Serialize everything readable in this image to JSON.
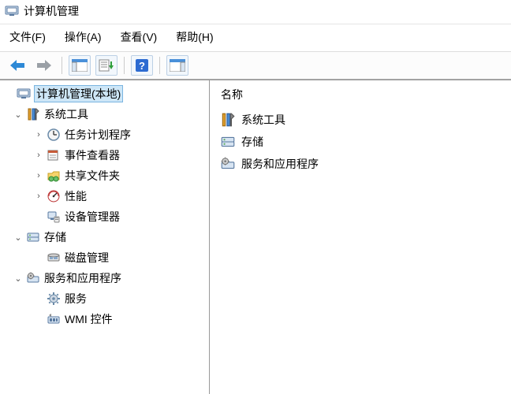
{
  "titlebar": {
    "title": "计算机管理"
  },
  "menu": {
    "file": "文件(F)",
    "action": "操作(A)",
    "view": "查看(V)",
    "help": "帮助(H)"
  },
  "tree": {
    "root": "计算机管理(本地)",
    "system_tools": "系统工具",
    "task_scheduler": "任务计划程序",
    "event_viewer": "事件查看器",
    "shared_folders": "共享文件夹",
    "performance": "性能",
    "device_manager": "设备管理器",
    "storage": "存储",
    "disk_management": "磁盘管理",
    "services_apps": "服务和应用程序",
    "services": "服务",
    "wmi_control": "WMI 控件"
  },
  "list": {
    "header": "名称",
    "items": {
      "system_tools": "系统工具",
      "storage": "存储",
      "services_apps": "服务和应用程序"
    }
  }
}
